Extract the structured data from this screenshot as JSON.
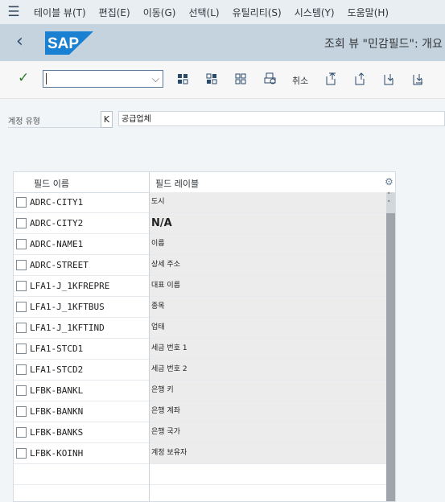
{
  "menu": [
    "테이블 뷰(T)",
    "편집(E)",
    "이동(G)",
    "선택(L)",
    "유틸리티(S)",
    "시스템(Y)",
    "도움말(H)"
  ],
  "header": {
    "brand": "SAP",
    "title": "조회 뷰 \"민감필드\": 개요"
  },
  "toolbar": {
    "command_value": "",
    "cancel_label": "취소"
  },
  "filter": {
    "label": "계정 유형",
    "key": "K",
    "value": "공급업체"
  },
  "table": {
    "columns": [
      "필드 이름",
      "필드 레이블"
    ],
    "rows": [
      {
        "name": "ADRC-CITY1",
        "label": "도시"
      },
      {
        "name": "ADRC-CITY2",
        "label": "N/A"
      },
      {
        "name": "ADRC-NAME1",
        "label": "이름"
      },
      {
        "name": "ADRC-STREET",
        "label": "상세 주소"
      },
      {
        "name": "LFA1-J_1KFREPRE",
        "label": "대표 이름"
      },
      {
        "name": "LFA1-J_1KFTBUS",
        "label": "종목"
      },
      {
        "name": "LFA1-J_1KFTIND",
        "label": "업태"
      },
      {
        "name": "LFA1-STCD1",
        "label": "세금 번호 1"
      },
      {
        "name": "LFA1-STCD2",
        "label": "세금 번호 2"
      },
      {
        "name": "LFBK-BANKL",
        "label": "은행 키"
      },
      {
        "name": "LFBK-BANKN",
        "label": "은행 계좌"
      },
      {
        "name": "LFBK-BANKS",
        "label": "은행 국가"
      },
      {
        "name": "LFBK-KOINH",
        "label": "계정 보유자"
      }
    ]
  },
  "colors": {
    "menu_bg": "#e9eef3",
    "title_bg": "#c5d3df",
    "sap_blue": "#1a80d1",
    "confirm_green": "#2b7d2b"
  },
  "icons": [
    "menu-icon",
    "back-icon",
    "confirm-icon",
    "dropdown-icon",
    "select-all-icon",
    "deselect-all-icon",
    "select-block-icon",
    "print-icon",
    "first-page-icon",
    "previous-page-icon",
    "next-page-icon",
    "last-page-icon",
    "settings-icon",
    "scroll-up-icon",
    "scroll-down-icon"
  ]
}
